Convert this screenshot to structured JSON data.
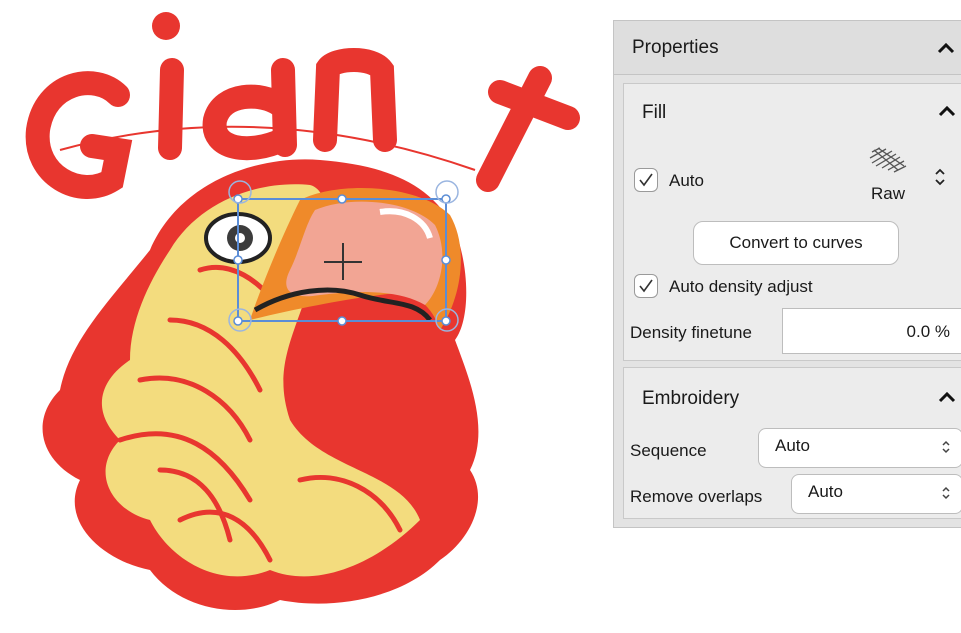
{
  "design": {
    "lettering": "Giant",
    "colors": {
      "thread_red": "#e8362f",
      "thread_yellow": "#f3dc7e",
      "beak_pink": "#f2a594",
      "beak_orange": "#ef8a2a",
      "selection": "#5b8dd6"
    }
  },
  "properties": {
    "title": "Properties",
    "collapse_icon": "chevron-up-icon",
    "fill": {
      "title": "Fill",
      "auto_label": "Auto",
      "auto_checked": true,
      "stitch_type_label": "Raw",
      "stitch_type_icon": "raw-stitch-icon",
      "convert_button": "Convert to curves",
      "auto_density_label": "Auto density adjust",
      "auto_density_checked": true,
      "density_label": "Density finetune",
      "density_value": "0.0 %"
    },
    "embroidery": {
      "title": "Embroidery",
      "sequence_label": "Sequence",
      "sequence_value": "Auto",
      "remove_overlaps_label": "Remove overlaps",
      "remove_overlaps_value": "Auto"
    }
  }
}
